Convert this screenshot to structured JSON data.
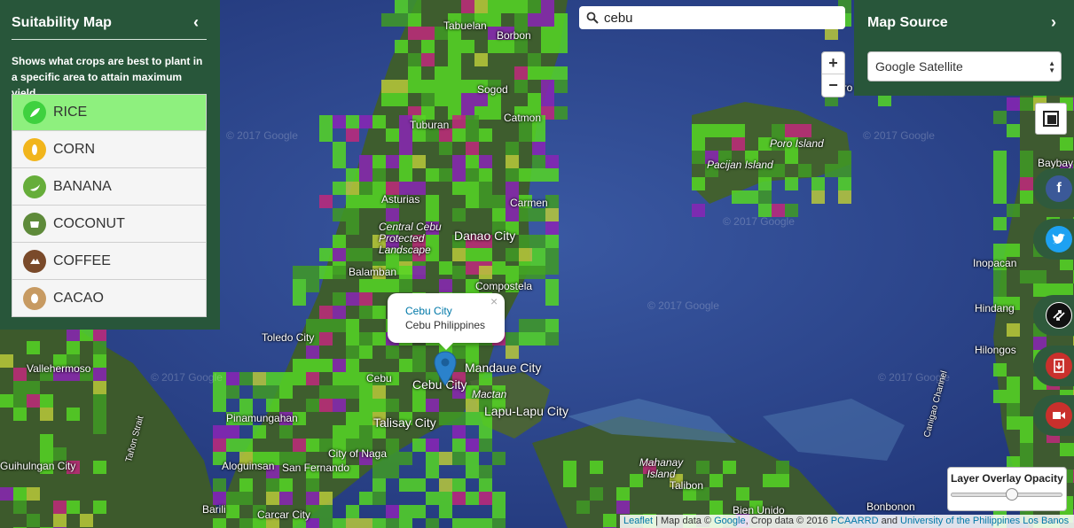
{
  "left_panel": {
    "title": "Suitability Map",
    "collapse_icon": "chevron-left-icon",
    "description": "Shows what crops are best to plant in a specific area to attain maximum yield.",
    "crops": [
      {
        "label": "RICE",
        "icon": "rice-icon",
        "color": "#3fd13f",
        "active": true
      },
      {
        "label": "CORN",
        "icon": "corn-icon",
        "color": "#f1b51c",
        "active": false
      },
      {
        "label": "BANANA",
        "icon": "banana-icon",
        "color": "#66ad3a",
        "active": false
      },
      {
        "label": "COCONUT",
        "icon": "coconut-icon",
        "color": "#5e8a3a",
        "active": false
      },
      {
        "label": "COFFEE",
        "icon": "coffee-icon",
        "color": "#7a4a2a",
        "active": false
      },
      {
        "label": "CACAO",
        "icon": "cacao-icon",
        "color": "#c79a62",
        "active": false
      }
    ]
  },
  "search": {
    "value": "cebu",
    "icon": "search-icon"
  },
  "zoom": {
    "in_label": "+",
    "out_label": "−"
  },
  "map_source": {
    "title": "Map Source",
    "expand_icon": "chevron-right-icon",
    "selected": "Google Satellite"
  },
  "right_buttons": {
    "layers": "layers-icon",
    "facebook": "facebook-icon",
    "twitter": "twitter-icon",
    "swap": "swap-icon",
    "download": "download-icon",
    "video": "video-icon"
  },
  "opacity": {
    "label": "Layer Overlay Opacity",
    "value": 0.55
  },
  "popup": {
    "title": "Cebu City",
    "subtitle": "Cebu Philippines",
    "close": "×"
  },
  "map": {
    "places": [
      {
        "name": "Tabuelan",
        "style": "place"
      },
      {
        "name": "Borbon",
        "style": "place"
      },
      {
        "name": "Sogod",
        "style": "place"
      },
      {
        "name": "Tuburan",
        "style": "place"
      },
      {
        "name": "Catmon",
        "style": "place"
      },
      {
        "name": "Asturias",
        "style": "place"
      },
      {
        "name": "Carmen",
        "style": "place"
      },
      {
        "name": "Central Cebu Protected Landscape",
        "style": "italic"
      },
      {
        "name": "Danao City",
        "style": "place big"
      },
      {
        "name": "Balamban",
        "style": "place"
      },
      {
        "name": "Compostela",
        "style": "place"
      },
      {
        "name": "Toledo City",
        "style": "place"
      },
      {
        "name": "Mandaue City",
        "style": "place big"
      },
      {
        "name": "Cebu",
        "style": "place"
      },
      {
        "name": "Cebu City",
        "style": "place big"
      },
      {
        "name": "Mactan",
        "style": "place italic"
      },
      {
        "name": "Lapu-Lapu City",
        "style": "place big"
      },
      {
        "name": "Talisay City",
        "style": "place big"
      },
      {
        "name": "Vallehermoso",
        "style": "place"
      },
      {
        "name": "Pinamungahan",
        "style": "place"
      },
      {
        "name": "City of Naga",
        "style": "place"
      },
      {
        "name": "Aloguinsan",
        "style": "place"
      },
      {
        "name": "San Fernando",
        "style": "place"
      },
      {
        "name": "Barili",
        "style": "place"
      },
      {
        "name": "Carcar City",
        "style": "place"
      },
      {
        "name": "Guihulngan City",
        "style": "place"
      },
      {
        "name": "Mahanay Island",
        "style": "place italic"
      },
      {
        "name": "Talibon",
        "style": "place"
      },
      {
        "name": "Bien Unido",
        "style": "place"
      },
      {
        "name": "Bonbonon",
        "style": "place"
      },
      {
        "name": "Poro Island",
        "style": "place italic"
      },
      {
        "name": "Pacijan Island",
        "style": "place italic"
      },
      {
        "name": "Poro",
        "style": "place"
      },
      {
        "name": "Baybay",
        "style": "place"
      },
      {
        "name": "Inopacan",
        "style": "place"
      },
      {
        "name": "Hindang",
        "style": "place"
      },
      {
        "name": "Hilongos",
        "style": "place"
      },
      {
        "name": "Tañon Strait",
        "style": "place"
      },
      {
        "name": "Canigao Channel",
        "style": "place"
      }
    ],
    "watermark": "© 2017 Google"
  },
  "attribution": {
    "leaflet": "Leaflet",
    "sep1": " | Map data © ",
    "google": "Google",
    "sep2": ", Crop data © 2016 ",
    "pcaarrd": "PCAARRD",
    "sep3": " and ",
    "uplb": "University of the Philippines Los Banos"
  },
  "colors": {
    "panel": "#28563a",
    "sea": "#2f4a8f",
    "land": "#3d5a2c",
    "crop_bright": "#55d624",
    "crop_dark": "#3f9a24",
    "crop_purple": "#8a25b5",
    "crop_magenta": "#c0297b",
    "crop_yellow": "#b9c93a"
  }
}
